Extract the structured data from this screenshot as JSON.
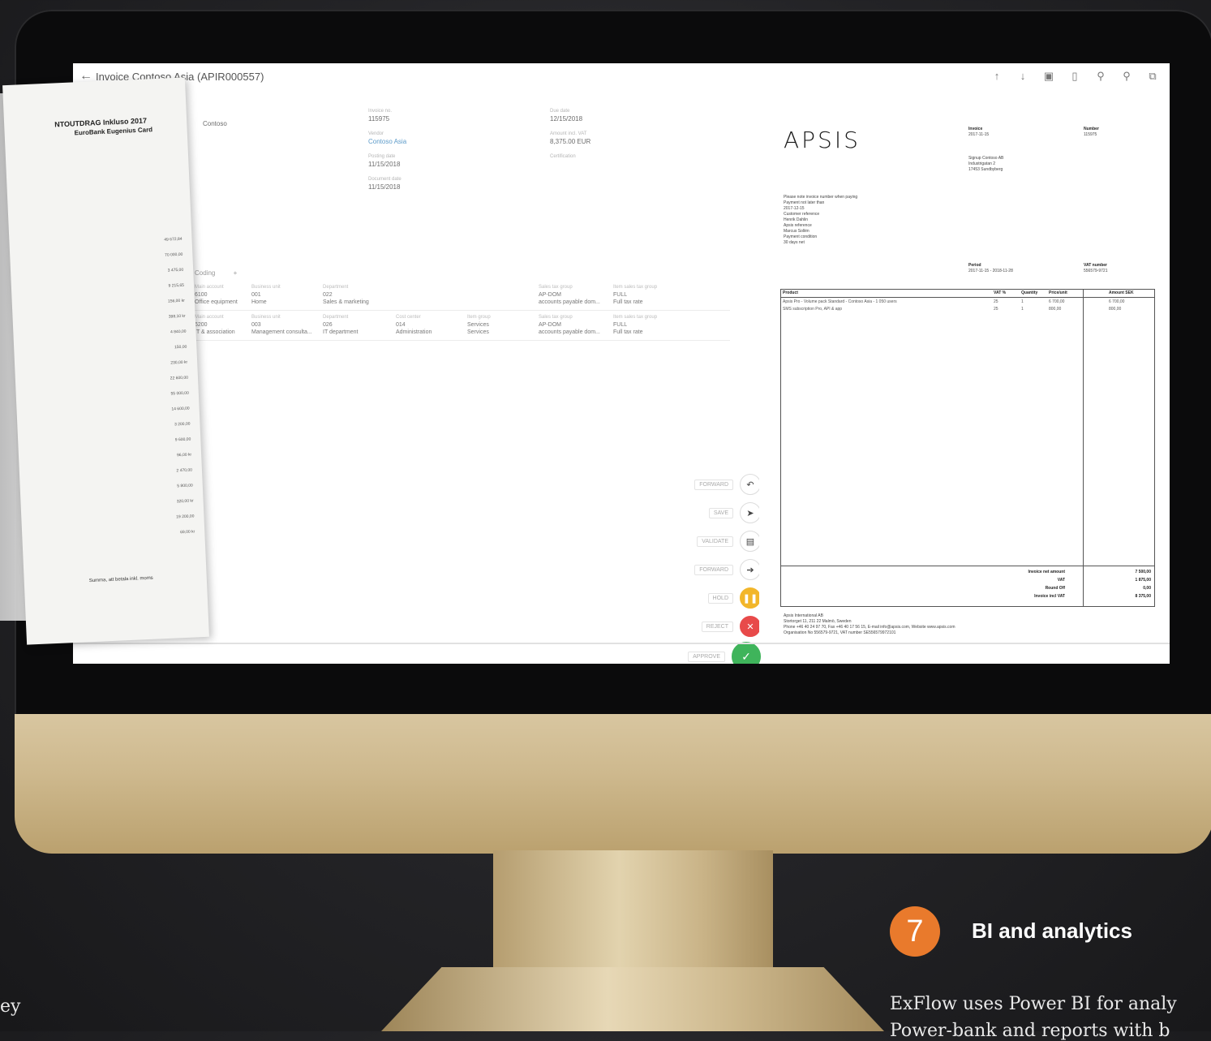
{
  "window": {
    "title": "Invoice Contoso Asia (APIR000557)"
  },
  "toolbar": {
    "icons": [
      "arrow-up-icon",
      "arrow-down-icon",
      "image-icon",
      "attachment-icon",
      "zoom-in-icon",
      "zoom-out-icon",
      "open-external-icon"
    ],
    "glyphs": [
      "↑",
      "↓",
      "▣",
      "▯",
      "⚲",
      "⚲",
      "⧉"
    ]
  },
  "header_fields": {
    "left_value": "Contoso",
    "col1": [
      {
        "label": "Invoice no.",
        "value": "115975",
        "link": false
      },
      {
        "label": "Vendor",
        "value": "Contoso Asia",
        "link": true
      },
      {
        "label": "Posting date",
        "value": "11/15/2018",
        "link": false
      },
      {
        "label": "Document date",
        "value": "11/15/2018",
        "link": false
      }
    ],
    "col2": [
      {
        "label": "Due date",
        "value": "12/15/2018",
        "link": false
      },
      {
        "label": "Amount incl. VAT",
        "value": "8,375.00 EUR",
        "link": false
      },
      {
        "label": "Certification",
        "value": "",
        "link": false
      }
    ]
  },
  "coding_grid": {
    "tabs": [
      "Coding",
      "+"
    ],
    "rows": [
      [
        {
          "h": "Main account",
          "v1": "6100",
          "v2": "Office equipment"
        },
        {
          "h": "Business unit",
          "v1": "001",
          "v2": "Home"
        },
        {
          "h": "Department",
          "v1": "022",
          "v2": "Sales & marketing"
        },
        {
          "h": "",
          "v1": "",
          "v2": ""
        },
        {
          "h": "",
          "v1": "",
          "v2": ""
        },
        {
          "h": "Sales tax group",
          "v1": "AP-DOM",
          "v2": "accounts payable dom..."
        },
        {
          "h": "Item sales tax group",
          "v1": "FULL",
          "v2": "Full tax rate"
        }
      ],
      [
        {
          "h": "Main account",
          "v1": "6200",
          "v2": "IT & association"
        },
        {
          "h": "Business unit",
          "v1": "003",
          "v2": "Management consulta..."
        },
        {
          "h": "Department",
          "v1": "026",
          "v2": "IT department"
        },
        {
          "h": "Cost center",
          "v1": "014",
          "v2": "Administration"
        },
        {
          "h": "Item group",
          "v1": "Services",
          "v2": "Services"
        },
        {
          "h": "Sales tax group",
          "v1": "AP-DOM",
          "v2": "accounts payable dom..."
        },
        {
          "h": "Item sales tax group",
          "v1": "FULL",
          "v2": "Full tax rate"
        }
      ]
    ]
  },
  "actions": [
    {
      "label": "FORWARD",
      "icon": "undo-icon",
      "glyph": "↶",
      "kind": "plain"
    },
    {
      "label": "SAVE",
      "icon": "send-icon",
      "glyph": "➤",
      "kind": "plain"
    },
    {
      "label": "VALIDATE",
      "icon": "clipboard-icon",
      "glyph": "▤",
      "kind": "plain"
    },
    {
      "label": "FORWARD",
      "icon": "forward-icon",
      "glyph": "➔",
      "kind": "plain"
    },
    {
      "label": "HOLD",
      "icon": "pause-icon",
      "glyph": "❚❚",
      "kind": "hold"
    },
    {
      "label": "REJECT",
      "icon": "close-icon",
      "glyph": "✕",
      "kind": "reject"
    },
    {
      "label": "APPROVE",
      "icon": "check-icon",
      "glyph": "✓",
      "kind": "approve"
    }
  ],
  "receipt": {
    "header1": "NTOUTDRAG Inkluso 2017",
    "header2": "EuroBank Eugenius Card",
    "amounts": [
      "49 672,84",
      "70 000,00",
      "3 475,00",
      "9 215,65",
      "156,00 kr",
      "398,10 kr",
      "4 840,00",
      "150,00",
      "230,00 kr",
      "22 600,00",
      "55 000,00",
      "14 600,00",
      "3 200,00",
      "9 600,00",
      "96,00 kr",
      "2 470,00",
      "5 800,00",
      "320,00 kr",
      "19 200,00",
      "69,00 kr"
    ],
    "footer": "Summa, att betala inkl. moms"
  },
  "document": {
    "logo": "APSIS",
    "invoice_label": "Invoice",
    "invoice_date": "2017-11-15",
    "number_label": "Number",
    "number": "115975",
    "recipient": [
      "Signup Contoso AB",
      "Industrigatan 2",
      "17453 Sundbyberg"
    ],
    "payment_lines": [
      "Please note invoice number when paying",
      "Payment not later than",
      "2017-12-15",
      "Customer reference",
      "Henrik Dahlin",
      "Apsis reference",
      "Marcus Sollén",
      "Payment condition",
      "30 days net"
    ],
    "period_label": "Period",
    "period": "2017-11-15 - 2018-11-28",
    "vat_label": "VAT number",
    "vat_number": "556579-9721",
    "columns": [
      "Product",
      "VAT %",
      "Quantity",
      "Price/unit",
      "Amount SEK"
    ],
    "lines": [
      {
        "product": "Apsis Pro - Volume pack Standard - Contoso Asia - 1 050 users",
        "vat": "25",
        "qty": "1",
        "price": "6 700,00",
        "amount": "6 700,00"
      },
      {
        "product": "SMS subscription Pro, API & app",
        "vat": "25",
        "qty": "1",
        "price": "800,00",
        "amount": "800,00"
      }
    ],
    "totals": [
      {
        "label": "Invoice net amount",
        "value": "7 500,00"
      },
      {
        "label": "VAT",
        "value": "1 875,00"
      },
      {
        "label": "Round Off",
        "value": "0,00"
      },
      {
        "label": "Invoice incl VAT",
        "value": "8 375,00"
      }
    ],
    "footer_lines": [
      "Apsis International AB",
      "Stortorget 11, 211 22 Malmö, Sweden",
      "Phone +46 40 24 97 70, Fax +46 40 17 56 15, E-mail info@apsis.com, Website www.apsis.com",
      "Organisation No 556579-9721, VAT number SE556579972101"
    ]
  },
  "marketing": {
    "number": "7",
    "heading": "BI and analytics",
    "line1": "ExFlow uses Power BI for analy",
    "line2": "Power-bank and reports with b",
    "left_fragment": "ey"
  }
}
